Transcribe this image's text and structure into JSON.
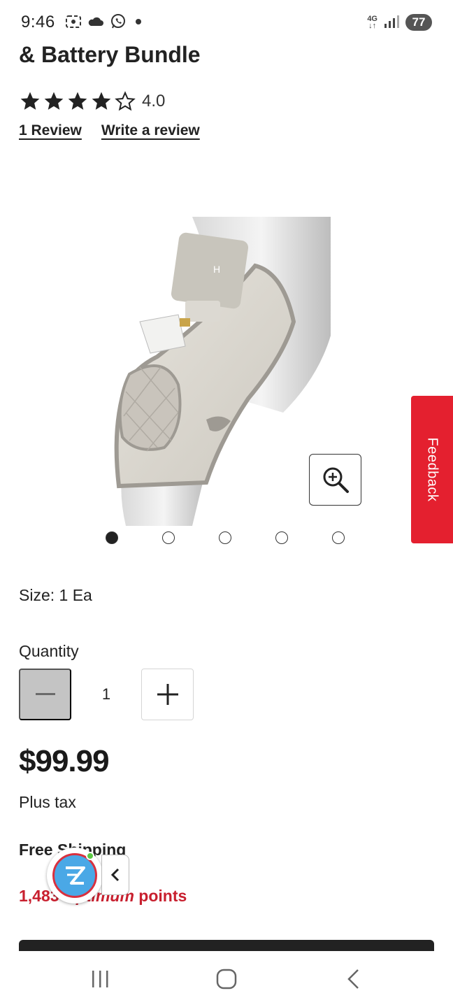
{
  "status_bar": {
    "time": "9:46",
    "network": "4G",
    "battery": "77",
    "icons": [
      "screenshot-icon",
      "cloud-icon",
      "whatsapp-icon",
      "notification-dot",
      "signal-icon",
      "battery-icon"
    ]
  },
  "product": {
    "title": "& Battery Bundle",
    "rating": 4.0,
    "rating_text": "4.0",
    "stars_filled": 4,
    "stars_total": 5,
    "reviews_link": "1 Review",
    "write_review_link": "Write a review",
    "image_icon": "knee-brace-image",
    "carousel": {
      "count": 5,
      "active_index": 0
    },
    "size_text": "Size: 1 Ea",
    "quantity_label": "Quantity",
    "quantity_value": "1",
    "price": "$99.99",
    "tax_note": "Plus tax",
    "shipping": "Free Shipping",
    "points_prefix": "1,483",
    "points_brand": "Optimum",
    "points_suffix": "points"
  },
  "feedback_label": "Feedback",
  "colors": {
    "feedback_red": "#e4202f",
    "points_red": "#c8202f",
    "minus_disabled": "#c4c4c4"
  },
  "nav": {
    "icons": [
      "recent-apps-icon",
      "home-icon",
      "back-icon"
    ]
  }
}
